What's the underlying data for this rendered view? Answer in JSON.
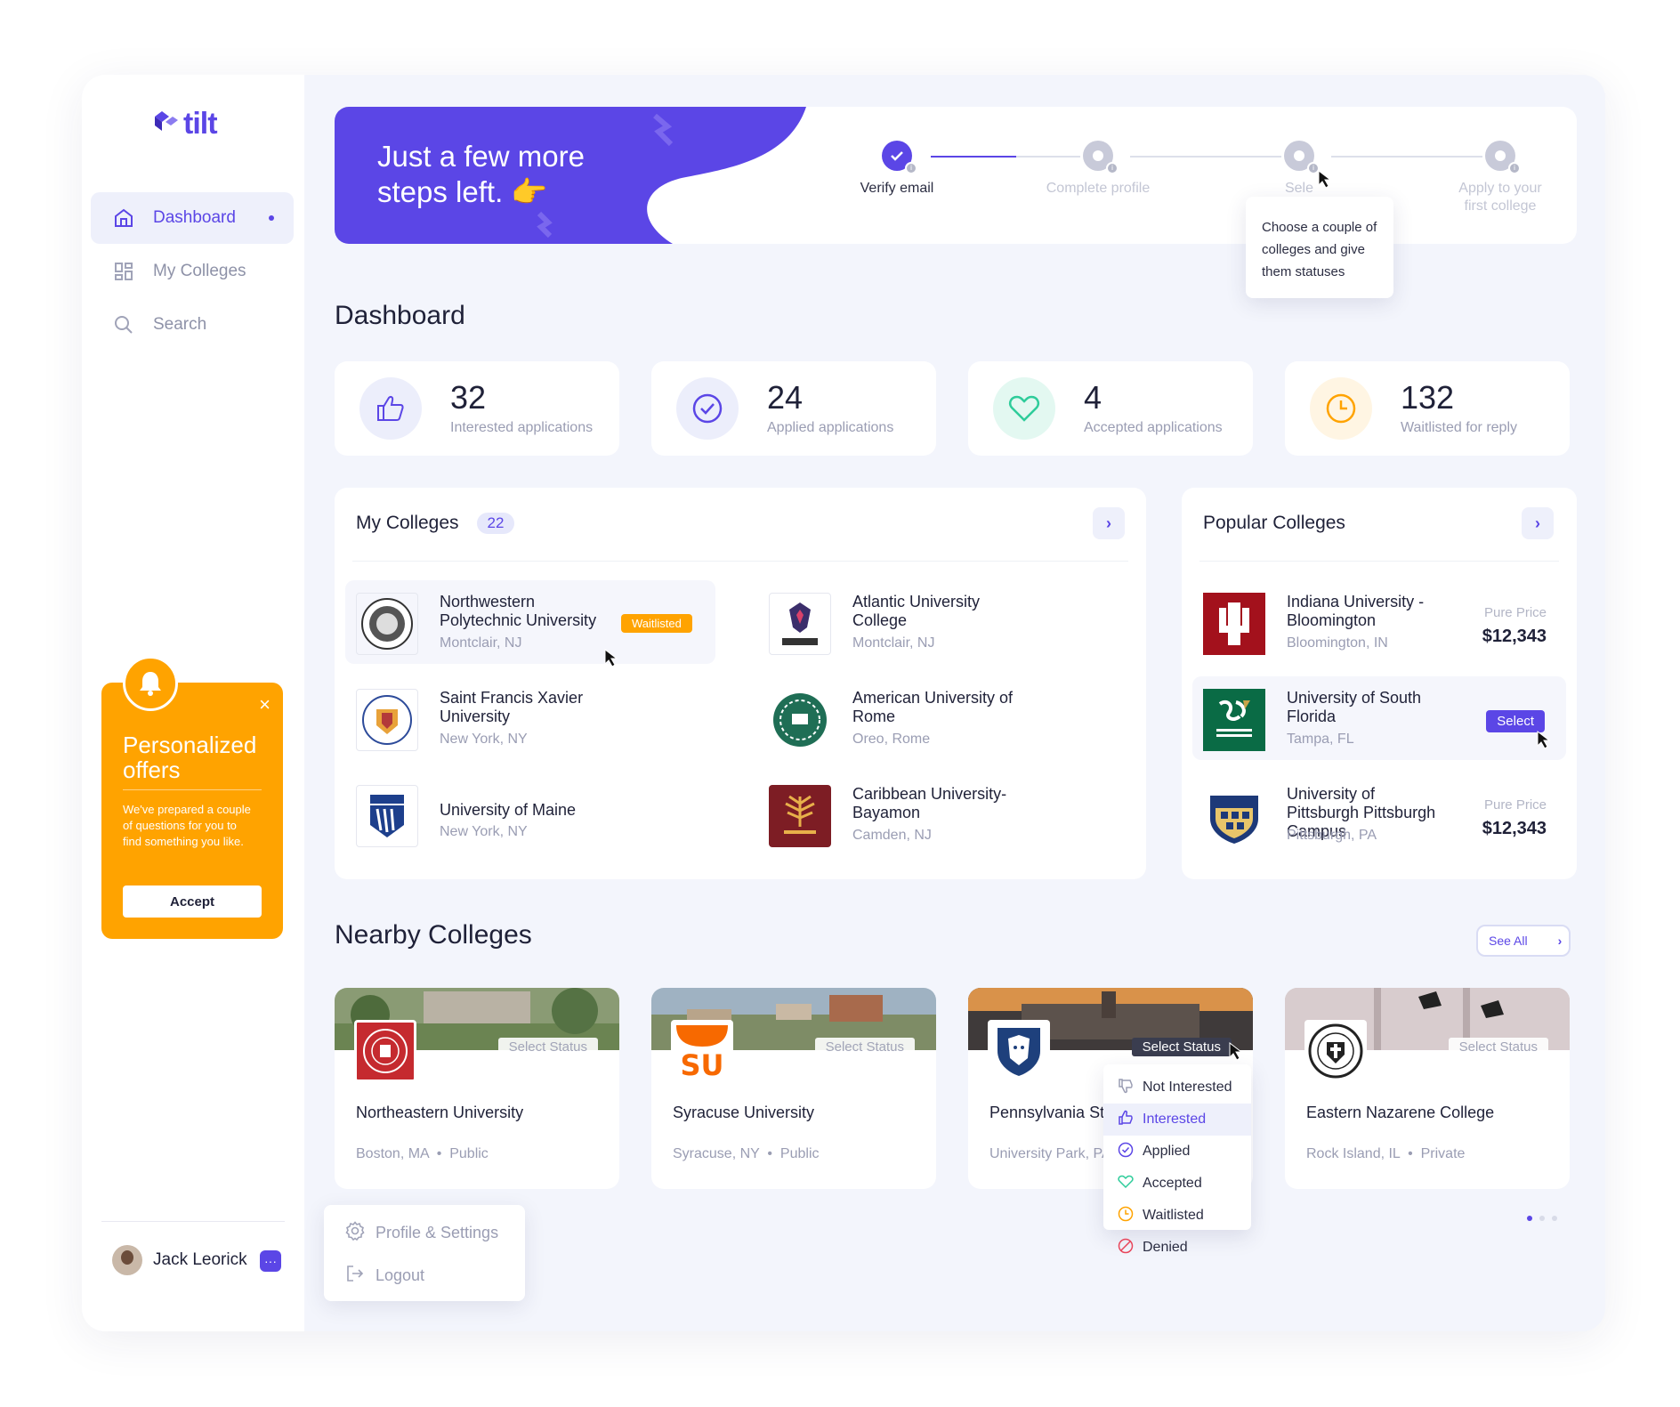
{
  "app": {
    "logo_text": "tilt",
    "brand_color": "#5b46e6",
    "accent_color": "#ffa300"
  },
  "sidebar": {
    "items": [
      {
        "label": "Dashboard",
        "icon": "home-icon",
        "active": true
      },
      {
        "label": "My Colleges",
        "icon": "grid-icon",
        "active": false
      },
      {
        "label": "Search",
        "icon": "search-icon",
        "active": false
      }
    ]
  },
  "offer": {
    "title": "Personalized offers",
    "text": "We've prepared a couple of questions for you to find something you like.",
    "accept_label": "Accept",
    "close_label": "×"
  },
  "user": {
    "name": "Jack Leorick",
    "menu_label": "···"
  },
  "profile_menu": {
    "items": [
      {
        "label": "Profile & Settings",
        "icon": "gear-icon"
      },
      {
        "label": "Logout",
        "icon": "logout-icon"
      }
    ]
  },
  "steps": {
    "title": "Just a few more steps left. 👉",
    "items": [
      {
        "label": "Verify email",
        "done": true
      },
      {
        "label": "Complete profile",
        "done": false
      },
      {
        "label": "Sele",
        "done": false
      },
      {
        "label": "Apply to your first college",
        "done": false
      }
    ],
    "tooltip": "Choose a couple of colleges and give them statuses"
  },
  "dashboard": {
    "title": "Dashboard",
    "stats": [
      {
        "value": "32",
        "label": "Interested applications",
        "icon": "thumbs-up-icon",
        "color": "#5b46e6",
        "bg": "#eceefb"
      },
      {
        "value": "24",
        "label": "Applied applications",
        "icon": "check-circle-icon",
        "color": "#5b46e6",
        "bg": "#eceefb"
      },
      {
        "value": "4",
        "label": "Accepted applications",
        "icon": "heart-icon",
        "color": "#2ecc9a",
        "bg": "#e3f8f1"
      },
      {
        "value": "132",
        "label": "Waitlisted for reply",
        "icon": "clock-icon",
        "color": "#ffa300",
        "bg": "#fff5e3"
      }
    ]
  },
  "my_colleges": {
    "title": "My Colleges",
    "count": "22",
    "items": [
      {
        "name": "Northwestern Polytechnic University",
        "loc": "Montclair, NJ",
        "badge": "Waitlisted"
      },
      {
        "name": "Atlantic University College",
        "loc": "Montclair, NJ"
      },
      {
        "name": "Saint Francis Xavier University",
        "loc": "New York, NY"
      },
      {
        "name": "American University of Rome",
        "loc": "Oreo, Rome"
      },
      {
        "name": "University of Maine",
        "loc": "New York, NY"
      },
      {
        "name": "Caribbean University-Bayamon",
        "loc": "Camden, NJ"
      }
    ]
  },
  "popular": {
    "title": "Popular Colleges",
    "items": [
      {
        "name": "Indiana University - Bloomington",
        "loc": "Bloomington, IN",
        "price_label": "Pure Price",
        "price": "$12,343"
      },
      {
        "name": "University of South Florida",
        "loc": "Tampa, FL",
        "action": "Select"
      },
      {
        "name": "University of Pittsburgh Pittsburgh Campus",
        "loc": "Pittsburgh, PA",
        "price_label": "Pure Price",
        "price": "$12,343"
      }
    ]
  },
  "nearby": {
    "title": "Nearby Colleges",
    "see_all": "See All",
    "items": [
      {
        "name": "Northeastern University",
        "loc": "Boston, MA",
        "type": "Public",
        "status": "Select Status"
      },
      {
        "name": "Syracuse University",
        "loc": "Syracuse, NY",
        "type": "Public",
        "status": "Select Status"
      },
      {
        "name": "Pennsylvania Sta",
        "loc": "University Park, PA",
        "status": "Select Status"
      },
      {
        "name": "Eastern Nazarene College",
        "loc": "Rock Island, IL",
        "type": "Private",
        "status": "Select Status"
      }
    ],
    "status_options": [
      {
        "label": "Not Interested",
        "icon": "thumbs-down-icon"
      },
      {
        "label": "Interested",
        "icon": "thumbs-up-icon",
        "selected": true
      },
      {
        "label": "Applied",
        "icon": "check-circle-icon"
      },
      {
        "label": "Accepted",
        "icon": "heart-icon"
      },
      {
        "label": "Waitlisted",
        "icon": "clock-icon"
      },
      {
        "label": "Denied",
        "icon": "denied-icon"
      }
    ]
  }
}
